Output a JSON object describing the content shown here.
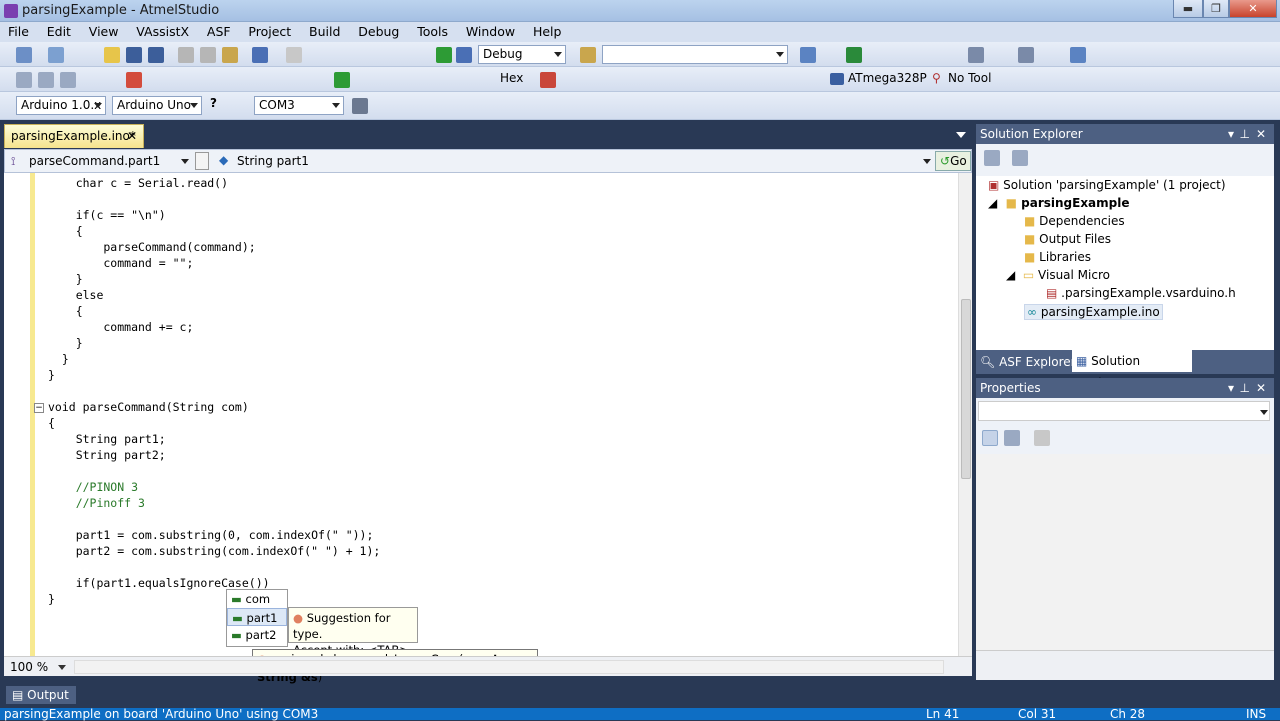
{
  "window": {
    "title": "parsingExample - AtmelStudio",
    "min": "▬",
    "max": "❐",
    "close": "✕"
  },
  "menu": [
    "File",
    "Edit",
    "View",
    "VAssistX",
    "ASF",
    "Project",
    "Build",
    "Debug",
    "Tools",
    "Window",
    "Help"
  ],
  "toolbar1": {
    "config": "Debug",
    "search": ""
  },
  "toolbar2": {
    "hex": "Hex",
    "device": "ATmega328P",
    "tool": "No Tool"
  },
  "toolbar3": {
    "arduino_version": "Arduino 1.0.x",
    "board": "Arduino Uno",
    "port": "COM3"
  },
  "editor": {
    "tab_label": "parsingExample.ino*",
    "nav_left": "parseCommand.part1",
    "nav_right": "String part1",
    "go": "Go",
    "zoom": "100 %",
    "code_lines": [
      "    char c = Serial.read()",
      "",
      "    if(c == \"\\n\")",
      "    {",
      "        parseCommand(command);",
      "        command = \"\";",
      "    }",
      "    else",
      "    {",
      "        command += c;",
      "    }",
      "  }",
      "}",
      "",
      "void parseCommand(String com)",
      "{",
      "    String part1;",
      "    String part2;",
      "",
      "    //PINON 3",
      "    //Pinoff 3",
      "",
      "    part1 = com.substring(0, com.indexOf(\" \"));",
      "    part2 = com.substring(com.indexOf(\" \") + 1);",
      "",
      "    if(part1.equalsIgnoreCase())",
      "}"
    ]
  },
  "autocomplete": {
    "items": [
      "com",
      "part1",
      "part2"
    ],
    "tip_title": "Suggestion for type.",
    "tip_accept": "Accept with: <TAB>",
    "signature_prefix": "unsigned char equalsIgnoreCase(",
    "signature_param": "const String &s",
    "signature_suffix": ")"
  },
  "solution_explorer": {
    "title": "Solution Explorer",
    "solution": "Solution 'parsingExample' (1 project)",
    "project": "parsingExample",
    "items": [
      "Dependencies",
      "Output Files",
      "Libraries",
      "Visual Micro"
    ],
    "subitem": ".parsingExample.vsarduino.h",
    "file": "parsingExample.ino",
    "tabs": [
      "ASF Explorer",
      "Solution Explorer"
    ]
  },
  "properties": {
    "title": "Properties"
  },
  "output": {
    "label": "Output"
  },
  "status": {
    "message": "parsingExample on board 'Arduino Uno' using COM3",
    "ln": "Ln 41",
    "col": "Col 31",
    "ch": "Ch 28",
    "mode": "INS"
  }
}
